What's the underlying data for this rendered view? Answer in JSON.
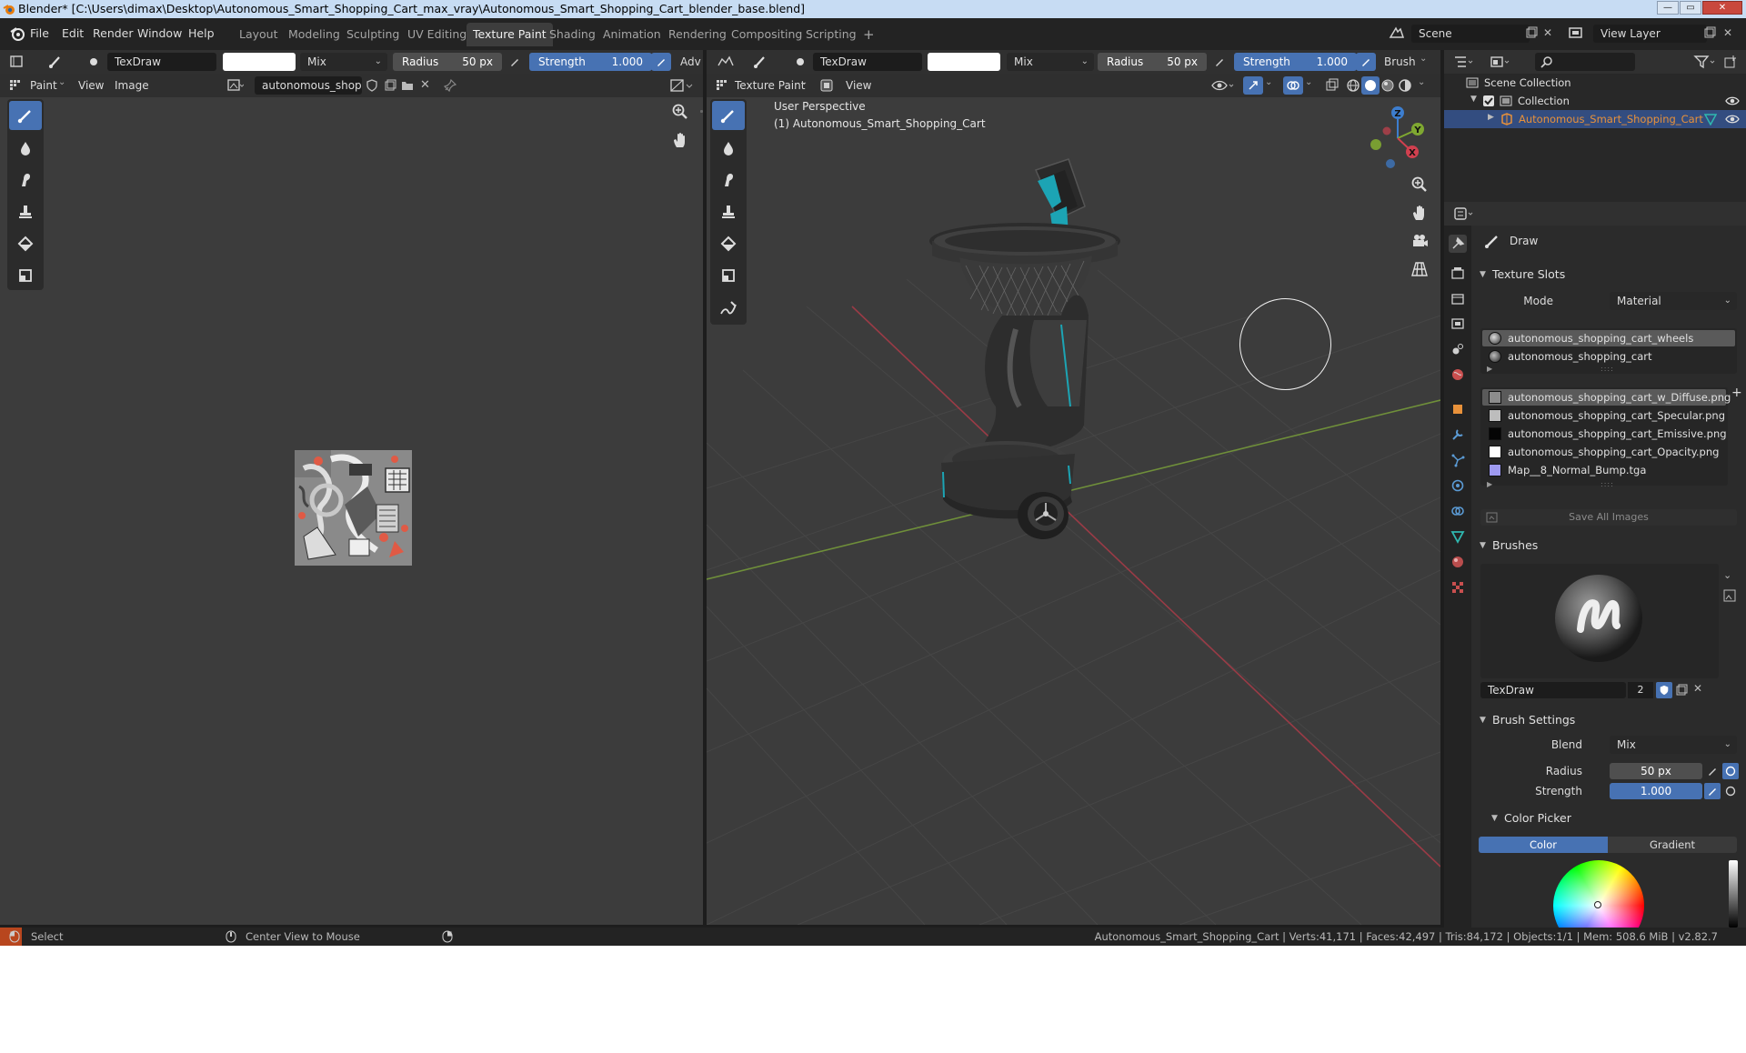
{
  "window": {
    "title": "Blender* [C:\\Users\\dimax\\Desktop\\Autonomous_Smart_Shopping_Cart_max_vray\\Autonomous_Smart_Shopping_Cart_blender_base.blend]"
  },
  "menu": [
    "File",
    "Edit",
    "Render",
    "Window",
    "Help"
  ],
  "workspaces": [
    {
      "label": "Layout"
    },
    {
      "label": "Modeling"
    },
    {
      "label": "Sculpting"
    },
    {
      "label": "UV Editing"
    },
    {
      "label": "Texture Paint",
      "active": true
    },
    {
      "label": "Shading"
    },
    {
      "label": "Animation"
    },
    {
      "label": "Rendering"
    },
    {
      "label": "Compositing"
    },
    {
      "label": "Scripting"
    }
  ],
  "add_workspace": "+",
  "scene": {
    "label": "Scene",
    "view_layer": "View Layer"
  },
  "tool_header_left": {
    "brush": "TexDraw",
    "blend": "Mix",
    "radius_label": "Radius",
    "radius_value": "50 px",
    "strength_label": "Strength",
    "strength_value": "1.000",
    "overflow": "Adv"
  },
  "tool_header_right": {
    "brush": "TexDraw",
    "blend": "Mix",
    "radius_label": "Radius",
    "radius_value": "50 px",
    "strength_label": "Strength",
    "strength_value": "1.000",
    "brush_menu": "Brush"
  },
  "image_editor": {
    "mode": "Paint",
    "view": "View",
    "image_menu": "Image",
    "image_name": "autonomous_shoppi..."
  },
  "viewport": {
    "mode": "Texture Paint",
    "view": "View",
    "perspective": "User Perspective",
    "object": "(1) Autonomous_Smart_Shopping_Cart",
    "axes": {
      "z": "Z",
      "y": "Y",
      "x": "X"
    }
  },
  "outliner": {
    "scene_collection": "Scene Collection",
    "collection": "Collection",
    "object": "Autonomous_Smart_Shopping_Cart"
  },
  "properties": {
    "tool_name": "Draw",
    "texture_slots_title": "Texture Slots",
    "mode_label": "Mode",
    "mode_value": "Material",
    "materials": [
      "autonomous_shopping_cart_wheels",
      "autonomous_shopping_cart"
    ],
    "images": [
      {
        "name": "autonomous_shopping_cart_w_Diffuse.png",
        "color": "#8c8c8c"
      },
      {
        "name": "autonomous_shopping_cart_Specular.png",
        "color": "#bdbdbd"
      },
      {
        "name": "autonomous_shopping_cart_Emissive.png",
        "color": "#050505"
      },
      {
        "name": "autonomous_shopping_cart_Opacity.png",
        "color": "#ffffff"
      },
      {
        "name": "Map__8_Normal_Bump.tga",
        "color": "#9e9af0"
      }
    ],
    "save_all": "Save All Images",
    "brushes_title": "Brushes",
    "brush_name": "TexDraw",
    "brush_users": "2",
    "brush_settings_title": "Brush Settings",
    "blend_label": "Blend",
    "blend_value": "Mix",
    "radius_label": "Radius",
    "radius_value": "50 px",
    "strength_label": "Strength",
    "strength_value": "1.000",
    "color_picker_title": "Color Picker",
    "color_tab": "Color",
    "gradient_tab": "Gradient"
  },
  "status": {
    "select": "Select",
    "center": "Center View to Mouse",
    "stats": "Autonomous_Smart_Shopping_Cart | Verts:41,171 | Faces:42,497 | Tris:84,172 | Objects:1/1 | Mem: 508.6 MiB | v2.82.7"
  },
  "colors": {
    "accent": "#4772b3",
    "viewport_bg": "#3c3c3c",
    "object_highlight": "#e8913a",
    "teal": "#1ca4b4"
  }
}
